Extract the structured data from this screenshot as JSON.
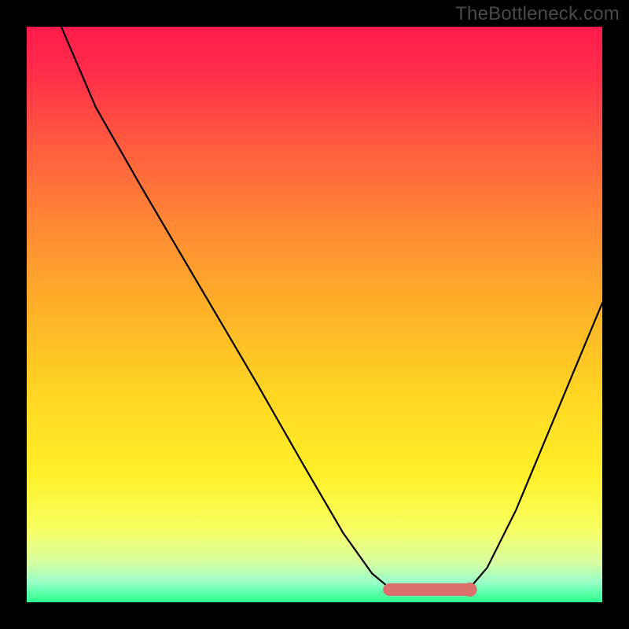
{
  "watermark": "TheBottleneck.com",
  "chart_data": {
    "type": "line",
    "title": "",
    "xlabel": "",
    "ylabel": "",
    "xlim": [
      0,
      100
    ],
    "ylim": [
      0,
      100
    ],
    "gradient_stops": [
      {
        "offset": 0.0,
        "color": "#ff1a4b"
      },
      {
        "offset": 0.08,
        "color": "#ff2d49"
      },
      {
        "offset": 0.2,
        "color": "#ff5a3f"
      },
      {
        "offset": 0.35,
        "color": "#ff8a34"
      },
      {
        "offset": 0.5,
        "color": "#ffb428"
      },
      {
        "offset": 0.65,
        "color": "#ffd823"
      },
      {
        "offset": 0.78,
        "color": "#fff02a"
      },
      {
        "offset": 0.87,
        "color": "#f8ff60"
      },
      {
        "offset": 0.93,
        "color": "#d8ffa0"
      },
      {
        "offset": 0.965,
        "color": "#9affc8"
      },
      {
        "offset": 1.0,
        "color": "#28ff8d"
      }
    ],
    "curve_points": [
      {
        "x": 6.0,
        "y": 100.0
      },
      {
        "x": 12.0,
        "y": 86.0
      },
      {
        "x": 20.0,
        "y": 72.0
      },
      {
        "x": 30.0,
        "y": 55.0
      },
      {
        "x": 40.0,
        "y": 38.0
      },
      {
        "x": 48.0,
        "y": 24.0
      },
      {
        "x": 55.0,
        "y": 12.0
      },
      {
        "x": 60.0,
        "y": 5.0
      },
      {
        "x": 63.0,
        "y": 2.5
      },
      {
        "x": 66.0,
        "y": 2.0
      },
      {
        "x": 70.0,
        "y": 2.0
      },
      {
        "x": 74.0,
        "y": 2.0
      },
      {
        "x": 77.0,
        "y": 2.5
      },
      {
        "x": 80.0,
        "y": 6.0
      },
      {
        "x": 85.0,
        "y": 16.0
      },
      {
        "x": 90.0,
        "y": 28.0
      },
      {
        "x": 95.0,
        "y": 40.0
      },
      {
        "x": 100.0,
        "y": 52.0
      }
    ],
    "sweet_spot": {
      "x_start": 63.0,
      "x_end": 77.0,
      "y": 2.2,
      "color": "#d9716a",
      "stroke_width": 16,
      "dot_radius": 9
    },
    "curve_color": "#000000",
    "curve_width": 2.2
  }
}
